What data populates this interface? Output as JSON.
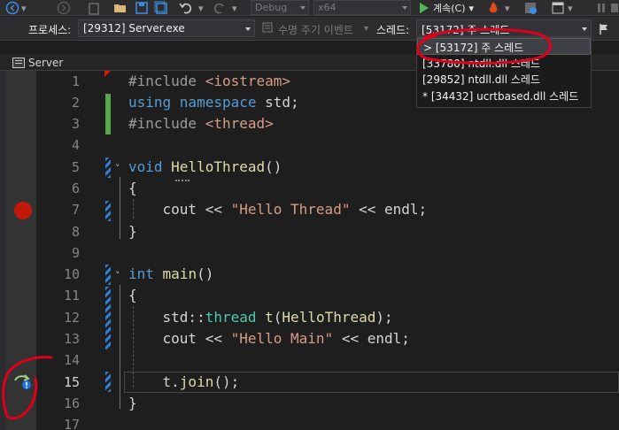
{
  "toolbar": {
    "config": "Debug",
    "platform": "x64",
    "continue_label": "계속(C)"
  },
  "location_bar": {
    "process_label": "프로세스:",
    "process_value": "[29312] Server.exe",
    "lifecycle_label": "수명 주기 이벤트",
    "thread_label": "스레드:",
    "thread_value": "[53172] 주 스레드"
  },
  "thread_dropdown": {
    "items": [
      "> [53172] 주 스레드",
      "[33780] ntdll.dll 스레드",
      "[29852] ntdll.dll 스레드",
      "* [34432] ucrtbased.dll 스레드"
    ]
  },
  "tab": {
    "label": "Server"
  },
  "editor": {
    "line_numbers": [
      "1",
      "2",
      "3",
      "4",
      "5",
      "6",
      "7",
      "8",
      "9",
      "10",
      "11",
      "12",
      "13",
      "14",
      "15",
      "16",
      "17"
    ],
    "current_line": 15,
    "breakpoint_line": 7
  },
  "colors": {
    "keyword": "#569cd6",
    "type": "#4ec9b0",
    "function": "#dcdcaa",
    "string": "#d69d85",
    "breakpoint": "#e51400",
    "annotation": "#e0001b"
  }
}
